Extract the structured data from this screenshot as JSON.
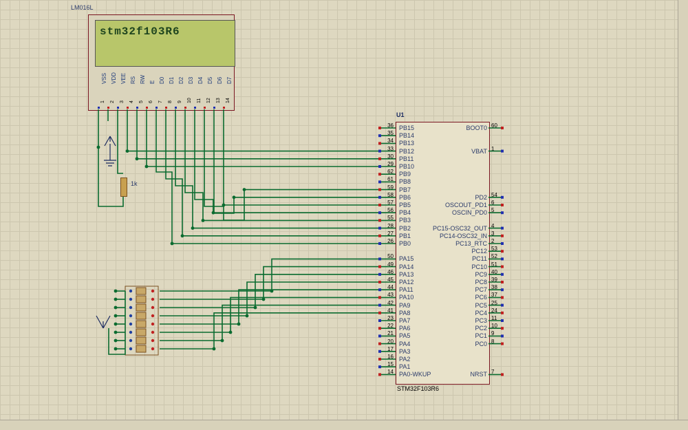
{
  "lcd": {
    "model_label": "LM016L",
    "display_text": "stm32f103R6",
    "pins": [
      {
        "n": "1",
        "name": "VSS"
      },
      {
        "n": "2",
        "name": "VDD"
      },
      {
        "n": "3",
        "name": "VEE"
      },
      {
        "n": "4",
        "name": "RS"
      },
      {
        "n": "5",
        "name": "RW"
      },
      {
        "n": "6",
        "name": "E"
      },
      {
        "n": "7",
        "name": "D0"
      },
      {
        "n": "8",
        "name": "D1"
      },
      {
        "n": "9",
        "name": "D2"
      },
      {
        "n": "10",
        "name": "D3"
      },
      {
        "n": "11",
        "name": "D4"
      },
      {
        "n": "12",
        "name": "D5"
      },
      {
        "n": "13",
        "name": "D6"
      },
      {
        "n": "14",
        "name": "D7"
      }
    ]
  },
  "mcu": {
    "refdes": "U1",
    "part": "STM32F103R6",
    "left_pins": [
      {
        "n": "36",
        "name": "PB15"
      },
      {
        "n": "35",
        "name": "PB14"
      },
      {
        "n": "34",
        "name": "PB13"
      },
      {
        "n": "33",
        "name": "PB12"
      },
      {
        "n": "30",
        "name": "PB11"
      },
      {
        "n": "29",
        "name": "PB10"
      },
      {
        "n": "62",
        "name": "PB9"
      },
      {
        "n": "61",
        "name": "PB8"
      },
      {
        "n": "59",
        "name": "PB7"
      },
      {
        "n": "58",
        "name": "PB6"
      },
      {
        "n": "57",
        "name": "PB5"
      },
      {
        "n": "56",
        "name": "PB4"
      },
      {
        "n": "55",
        "name": "PB3"
      },
      {
        "n": "28",
        "name": "PB2"
      },
      {
        "n": "27",
        "name": "PB1"
      },
      {
        "n": "26",
        "name": "PB0"
      },
      {
        "n": "",
        "name": ""
      },
      {
        "n": "50",
        "name": "PA15"
      },
      {
        "n": "49",
        "name": "PA14"
      },
      {
        "n": "46",
        "name": "PA13"
      },
      {
        "n": "45",
        "name": "PA12"
      },
      {
        "n": "44",
        "name": "PA11"
      },
      {
        "n": "43",
        "name": "PA10"
      },
      {
        "n": "42",
        "name": "PA9"
      },
      {
        "n": "41",
        "name": "PA8"
      },
      {
        "n": "23",
        "name": "PA7"
      },
      {
        "n": "22",
        "name": "PA6"
      },
      {
        "n": "21",
        "name": "PA5"
      },
      {
        "n": "20",
        "name": "PA4"
      },
      {
        "n": "17",
        "name": "PA3"
      },
      {
        "n": "16",
        "name": "PA2"
      },
      {
        "n": "15",
        "name": "PA1"
      },
      {
        "n": "14",
        "name": "PA0-WKUP"
      }
    ],
    "right_pins": [
      {
        "n": "60",
        "name": "BOOT0"
      },
      {
        "n": "",
        "name": ""
      },
      {
        "n": "",
        "name": ""
      },
      {
        "n": "1",
        "name": "VBAT"
      },
      {
        "n": "",
        "name": ""
      },
      {
        "n": "",
        "name": ""
      },
      {
        "n": "",
        "name": ""
      },
      {
        "n": "",
        "name": ""
      },
      {
        "n": "",
        "name": ""
      },
      {
        "n": "54",
        "name": "PD2"
      },
      {
        "n": "6",
        "name": "OSCOUT_PD1"
      },
      {
        "n": "5",
        "name": "OSCIN_PD0"
      },
      {
        "n": "",
        "name": ""
      },
      {
        "n": "4",
        "name": "PC15-OSC32_OUT"
      },
      {
        "n": "3",
        "name": "PC14-OSC32_IN"
      },
      {
        "n": "2",
        "name": "PC13_RTC"
      },
      {
        "n": "53",
        "name": "PC12"
      },
      {
        "n": "52",
        "name": "PC11"
      },
      {
        "n": "51",
        "name": "PC10"
      },
      {
        "n": "40",
        "name": "PC9"
      },
      {
        "n": "39",
        "name": "PC8"
      },
      {
        "n": "38",
        "name": "PC7"
      },
      {
        "n": "37",
        "name": "PC6"
      },
      {
        "n": "25",
        "name": "PC5"
      },
      {
        "n": "24",
        "name": "PC4"
      },
      {
        "n": "11",
        "name": "PC3"
      },
      {
        "n": "10",
        "name": "PC2"
      },
      {
        "n": "9",
        "name": "PC1"
      },
      {
        "n": "8",
        "name": "PC0"
      },
      {
        "n": "",
        "name": ""
      },
      {
        "n": "",
        "name": ""
      },
      {
        "n": "",
        "name": ""
      },
      {
        "n": "7",
        "name": "NRST"
      }
    ]
  },
  "components": {
    "resistor_value": "1k"
  },
  "wire_color": "#0a6b2f",
  "dot_color": "#0a6b2f",
  "chart_data": null
}
